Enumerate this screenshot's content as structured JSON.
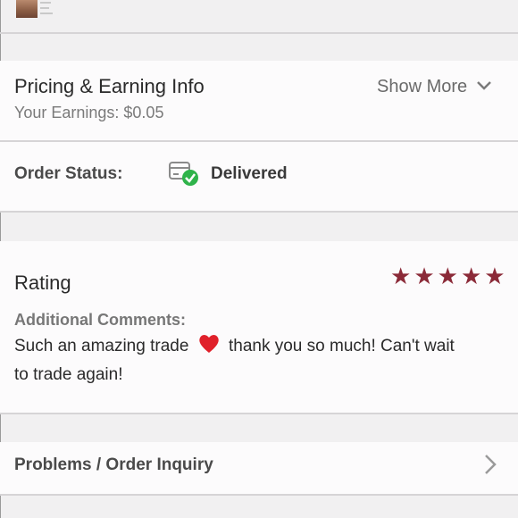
{
  "pricing": {
    "title": "Pricing & Earning Info",
    "earnings_label": "Your Earnings: $0.05",
    "show_more_label": "Show More"
  },
  "order_status": {
    "label": "Order Status:",
    "value": "Delivered",
    "icon": "package-delivered-icon",
    "check_color": "#2fb34a"
  },
  "rating": {
    "title": "Rating",
    "stars": 5,
    "max_stars": 5,
    "star_color": "#8b2a38",
    "comments_label": "Additional Comments:",
    "comment_part1": "Such an amazing trade",
    "comment_emoji": "heart-emoji",
    "comment_part2": "thank you so much! Can't wait",
    "comment_line2": "to trade again!"
  },
  "inquiry": {
    "label": "Problems / Order Inquiry"
  }
}
